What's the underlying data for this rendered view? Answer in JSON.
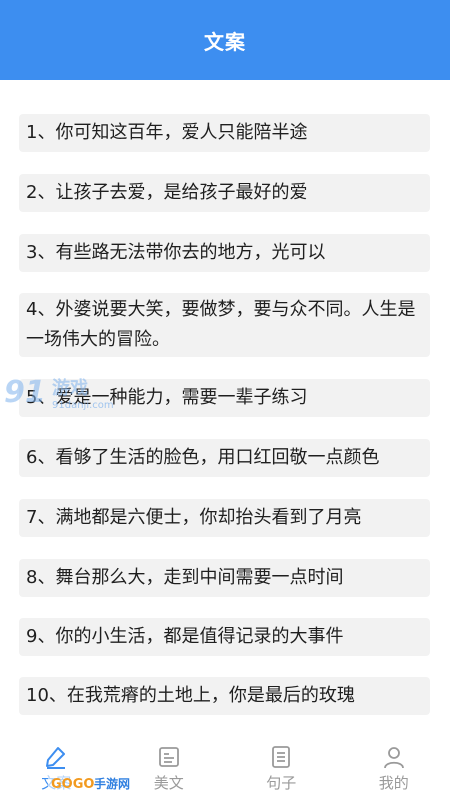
{
  "header": {
    "title": "文案"
  },
  "quotes": [
    "1、你可知这百年，爱人只能陪半途",
    "2、让孩子去爱，是给孩子最好的爱",
    "3、有些路无法带你去的地方，光可以",
    "4、外婆说要大笑，要做梦，要与众不同。人生是一场伟大的冒险。",
    "5、爱是一种能力，需要一辈子练习",
    "6、看够了生活的脸色，用口红回敬一点颜色",
    "7、满地都是六便士，你却抬头看到了月亮",
    "8、舞台那么大，走到中间需要一点时间",
    "9、你的小生活，都是值得记录的大事件",
    "10、在我荒瘠的土地上，你是最后的玫瑰"
  ],
  "tabs": [
    {
      "label": "文案",
      "icon": "pen-icon",
      "active": true
    },
    {
      "label": "美文",
      "icon": "article-icon",
      "active": false
    },
    {
      "label": "句子",
      "icon": "document-icon",
      "active": false
    },
    {
      "label": "我的",
      "icon": "user-icon",
      "active": false
    }
  ],
  "watermarks": {
    "site_logo_text": "91游戏",
    "site_url": "91danji.com",
    "bottom_logo_text": "GOGO手游网"
  },
  "colors": {
    "accent": "#3d8ef0",
    "card_bg": "#f2f2f2",
    "inactive": "#9a9a9a"
  }
}
